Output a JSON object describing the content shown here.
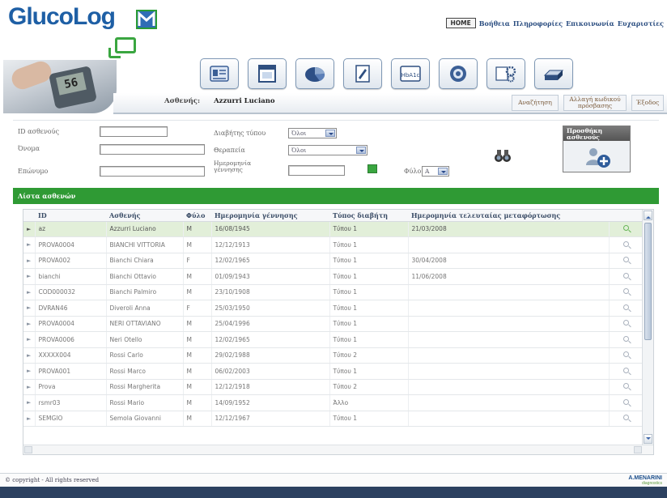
{
  "brand": {
    "name": "GlucoLog"
  },
  "topnav": {
    "home": "HOME",
    "links": [
      "Βοήθεια",
      "Πληροφορίες",
      "Επικοινωνία",
      "Ευχαριστίες"
    ]
  },
  "banner": {
    "meter_reading": "56"
  },
  "patient": {
    "label": "Ασθενής:",
    "name": "Azzurri Luciano"
  },
  "toolbar": {
    "icons": [
      "patient-card-icon",
      "window-icon",
      "pie-chart-icon",
      "notepad-icon",
      "hba1c-icon",
      "target-icon",
      "settings-icon",
      "printer-icon"
    ],
    "hba1c_label": "HbA1c"
  },
  "subnav": {
    "search": "Αναζήτηση",
    "change_code": "Αλλαγή κωδικού πρόσβασης",
    "exit": "Έξοδος"
  },
  "filters": {
    "id_label": "ID ασθενούς",
    "name_label": "Όνομα",
    "surname_label": "Επώνυμο",
    "diabetes_type_label": "Διαβήτης τύπου",
    "diabetes_type_value": "Όλοι",
    "therapy_label": "Θεραπεία",
    "therapy_value": "Όλοι",
    "birth_date_label": "Ημερομηνία γέννησης",
    "sex_label": "Φύλο",
    "sex_value": "A",
    "add_patient": "Προσθήκη ασθενούς"
  },
  "list": {
    "title": "Λίστα ασθενών",
    "columns": [
      "ID",
      "Ασθενής",
      "Φύλο",
      "Ημερομηνία γέννησης",
      "Τύπος διαβήτη",
      "Ημερομηνία τελευταίας μεταφόρτωσης"
    ],
    "rows": [
      {
        "id": "az",
        "patient": "Azzurri Luciano",
        "sex": "M",
        "birth": "16/08/1945",
        "type": "Τύπου 1",
        "upload": "21/03/2008",
        "selected": true
      },
      {
        "id": "PROVA0004",
        "patient": "BIANCHI VITTORIA",
        "sex": "M",
        "birth": "12/12/1913",
        "type": "Τύπου 1",
        "upload": ""
      },
      {
        "id": "PROVA002",
        "patient": "Bianchi Chiara",
        "sex": "F",
        "birth": "12/02/1965",
        "type": "Τύπου 1",
        "upload": "30/04/2008"
      },
      {
        "id": "bianchi",
        "patient": "Bianchi Ottavio",
        "sex": "M",
        "birth": "01/09/1943",
        "type": "Τύπου 1",
        "upload": "11/06/2008"
      },
      {
        "id": "COD000032",
        "patient": "Bianchi Palmiro",
        "sex": "M",
        "birth": "23/10/1908",
        "type": "Τύπου 1",
        "upload": ""
      },
      {
        "id": "DVRAN46",
        "patient": "Diveroli Anna",
        "sex": "F",
        "birth": "25/03/1950",
        "type": "Τύπου 1",
        "upload": ""
      },
      {
        "id": "PROVA0004",
        "patient": "NERI OTTAVIANO",
        "sex": "M",
        "birth": "25/04/1996",
        "type": "Τύπου 1",
        "upload": ""
      },
      {
        "id": "PROVA0006",
        "patient": "Neri Otello",
        "sex": "M",
        "birth": "12/02/1965",
        "type": "Τύπου 1",
        "upload": ""
      },
      {
        "id": "XXXXX004",
        "patient": "Rossi Carlo",
        "sex": "M",
        "birth": "29/02/1988",
        "type": "Τύπου 2",
        "upload": ""
      },
      {
        "id": "PROVA001",
        "patient": "Rossi Marco",
        "sex": "M",
        "birth": "06/02/2003",
        "type": "Τύπου 1",
        "upload": ""
      },
      {
        "id": "Prova",
        "patient": "Rossi Margherita",
        "sex": "M",
        "birth": "12/12/1918",
        "type": "Τύπου 2",
        "upload": ""
      },
      {
        "id": "rsmr03",
        "patient": "Rossi Mario",
        "sex": "M",
        "birth": "14/09/1952",
        "type": "Άλλο",
        "upload": ""
      },
      {
        "id": "SEMGIO",
        "patient": "Semola Giovanni",
        "sex": "M",
        "birth": "12/12/1967",
        "type": "Τύπου 1",
        "upload": ""
      }
    ]
  },
  "footer": {
    "copyright": "© copyright - All rights reserved",
    "logo": "A.MENARINI",
    "logo_sub": "diagnostics"
  }
}
